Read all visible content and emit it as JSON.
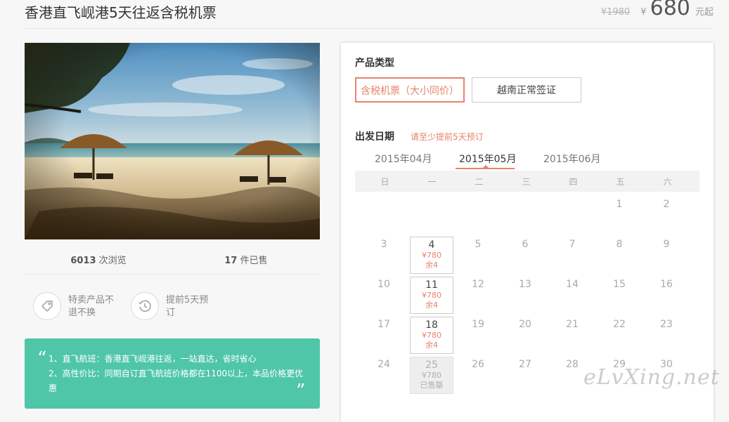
{
  "product": {
    "title": "香港直飞岘港5天往返含税机票",
    "price_original": "¥1980",
    "price_currency": "¥",
    "price_current": "680",
    "price_suffix": "元起"
  },
  "stats": {
    "views_count": "6013",
    "views_label": "次浏览",
    "sold_count": "17",
    "sold_label": "件已售"
  },
  "features": [
    {
      "icon": "tag-icon",
      "text": "特卖产品不退不换"
    },
    {
      "icon": "clock-history-icon",
      "text": "提前5天预订"
    }
  ],
  "promo": {
    "line1": "1、直飞航班：香港直飞岘港往返，一站直达，省时省心",
    "line2": "2、高性价比：同期自订直飞航班价格都在1100以上，本品价格更优惠",
    "open_quote": "“",
    "close_quote": "”"
  },
  "booking": {
    "product_type_label": "产品类型",
    "options": [
      "含税机票（大小同价）",
      "越南正常签证"
    ],
    "selected_option": 0,
    "date_label": "出发日期",
    "date_note": "请至少提前5天预订",
    "months": [
      "2015年04月",
      "2015年05月",
      "2015年06月"
    ],
    "active_month": 1,
    "weekdays": [
      "日",
      "一",
      "二",
      "三",
      "四",
      "五",
      "六"
    ],
    "days": [
      {
        "d": "1"
      },
      {
        "d": "2"
      },
      {
        "d": "3"
      },
      {
        "d": "4",
        "price": "¥780",
        "remain": "余4"
      },
      {
        "d": "5"
      },
      {
        "d": "6"
      },
      {
        "d": "7"
      },
      {
        "d": "8"
      },
      {
        "d": "9"
      },
      {
        "d": "10"
      },
      {
        "d": "11",
        "price": "¥780",
        "remain": "余4"
      },
      {
        "d": "12"
      },
      {
        "d": "13"
      },
      {
        "d": "14"
      },
      {
        "d": "15"
      },
      {
        "d": "16"
      },
      {
        "d": "17"
      },
      {
        "d": "18",
        "price": "¥780",
        "remain": "余4"
      },
      {
        "d": "19"
      },
      {
        "d": "20"
      },
      {
        "d": "21"
      },
      {
        "d": "22"
      },
      {
        "d": "23"
      },
      {
        "d": "24"
      },
      {
        "d": "25",
        "price": "¥780",
        "remain": "已售罄",
        "soldout": true
      },
      {
        "d": "26"
      },
      {
        "d": "27"
      },
      {
        "d": "28"
      },
      {
        "d": "29"
      },
      {
        "d": "30"
      }
    ]
  },
  "watermark": "eLvXing.net",
  "colors": {
    "accent": "#e8826b",
    "promo_bg": "#4fc6a8",
    "page_bg": "#f7f7f7"
  }
}
